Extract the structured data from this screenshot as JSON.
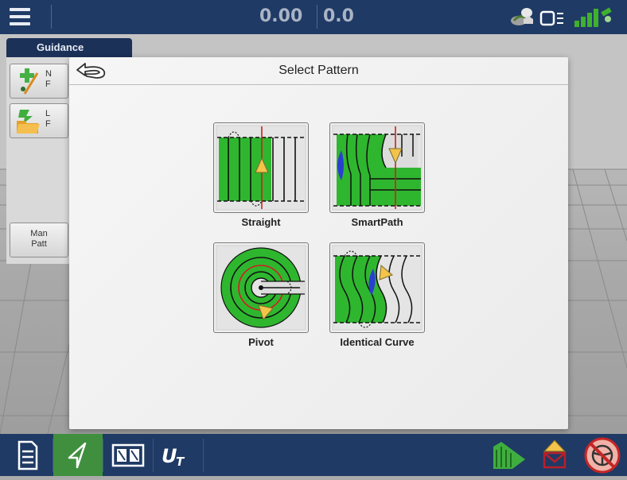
{
  "topbar": {
    "speed_readout": "0.00",
    "heading_readout": "0.0"
  },
  "guidance_tab": {
    "label": "Guidance"
  },
  "side_panel": {
    "buttons": [
      {
        "text_line1": "N",
        "text_line2": "F"
      },
      {
        "text_line1": "L",
        "text_line2": "F"
      }
    ],
    "manage_line1": "Man",
    "manage_line2": "Patt"
  },
  "dialog": {
    "title": "Select Pattern",
    "patterns": [
      {
        "label": "Straight"
      },
      {
        "label": "SmartPath"
      },
      {
        "label": "Pivot"
      },
      {
        "label": "Identical Curve"
      }
    ]
  },
  "colors": {
    "bar_bg": "#1f3a64",
    "active_tab": "#3f8f3f",
    "crop_green": "#2fb62f",
    "guide_red": "#d01f1f"
  },
  "icons": [
    "menu-icon",
    "field-status-icon",
    "implement-icon",
    "gps-signal-icon",
    "back-arrow-icon",
    "reports-icon",
    "guidance-icon",
    "split-screen-icon",
    "universal-terminal-icon",
    "coverage-map-icon",
    "alarm-icon",
    "steering-disabled-icon"
  ]
}
